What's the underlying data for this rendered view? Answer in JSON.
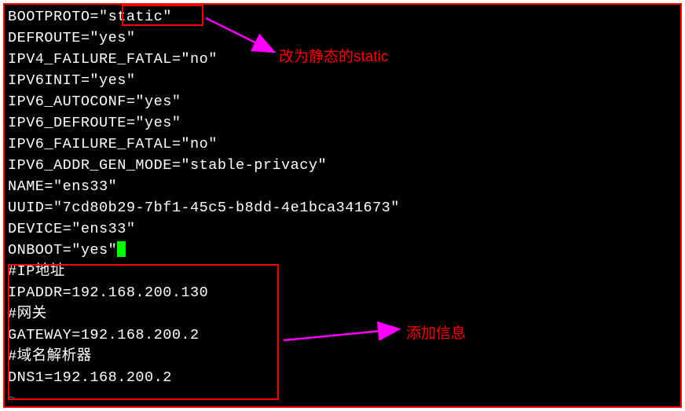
{
  "config": {
    "line1_key": "BOOTPROTO=\"",
    "line1_val": "static",
    "line1_end": "\"",
    "line2": "DEFROUTE=\"yes\"",
    "line3": "IPV4_FAILURE_FATAL=\"no\"",
    "line4": "IPV6INIT=\"yes\"",
    "line5": "IPV6_AUTOCONF=\"yes\"",
    "line6": "IPV6_DEFROUTE=\"yes\"",
    "line7": "IPV6_FAILURE_FATAL=\"no\"",
    "line8": "IPV6_ADDR_GEN_MODE=\"stable-privacy\"",
    "line9": "NAME=\"ens33\"",
    "line10": "UUID=\"7cd80b29-7bf1-45c5-b8dd-4e1bca341673\"",
    "line11": "DEVICE=\"ens33\"",
    "line12": "ONBOOT=\"yes\"",
    "line13": "#IP地址",
    "line14": "IPADDR=192.168.200.130",
    "line15": "#网关",
    "line16": "GATEWAY=192.168.200.2",
    "line17": "#域名解析器",
    "line18": "DNS1=192.168.200.2",
    "tilde": "~"
  },
  "annotations": {
    "note1": "改为静态的static",
    "note2": "添加信息"
  }
}
